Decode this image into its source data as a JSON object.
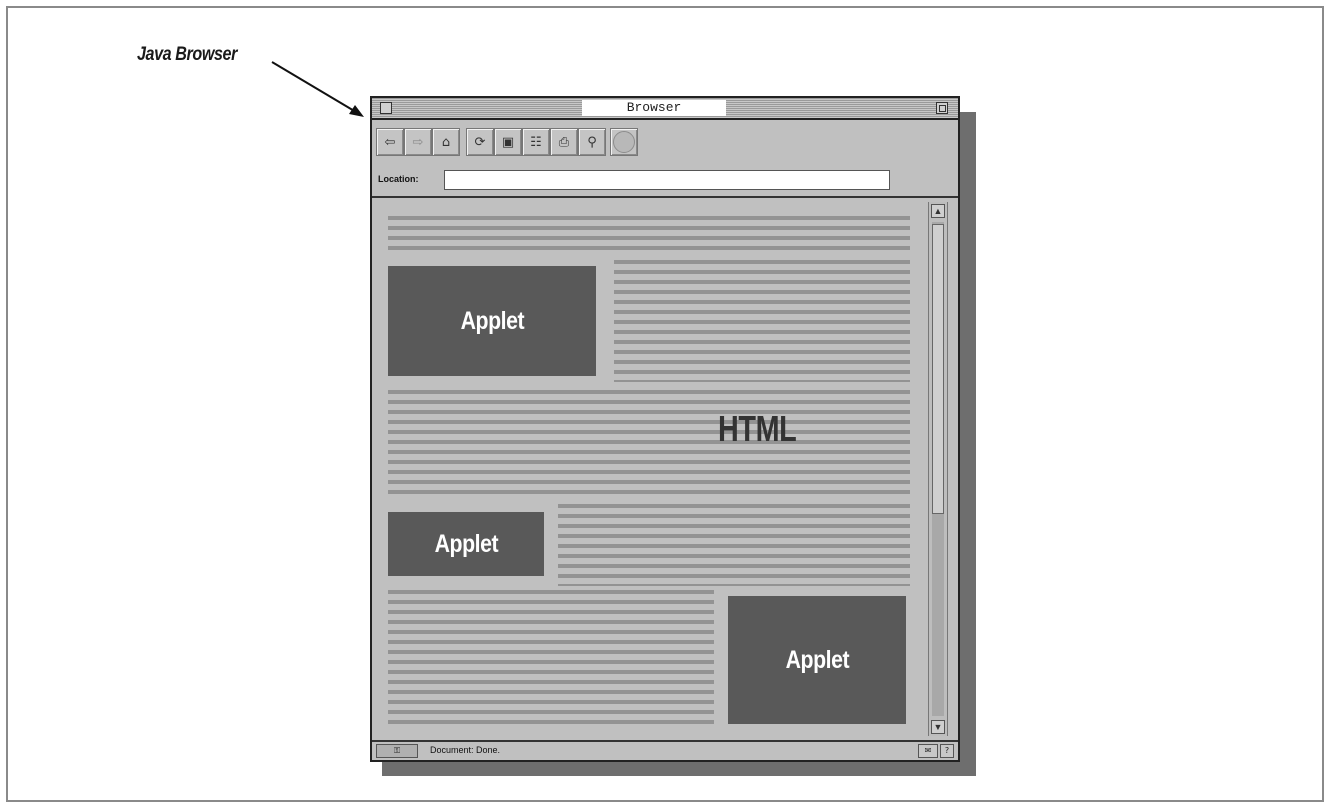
{
  "callout": {
    "label": "Java Browser"
  },
  "window": {
    "title": "Browser",
    "toolbar": {
      "buttons": [
        {
          "icon": "back-icon",
          "glyph": "⇦"
        },
        {
          "icon": "forward-icon",
          "glyph": "⇨"
        },
        {
          "icon": "home-icon",
          "glyph": "⌂"
        },
        {
          "icon": "reload-icon",
          "glyph": "⟳"
        },
        {
          "icon": "images-icon",
          "glyph": "▣"
        },
        {
          "icon": "open-icon",
          "glyph": "☷"
        },
        {
          "icon": "print-icon",
          "glyph": "⎙"
        },
        {
          "icon": "find-icon",
          "glyph": "⚲"
        },
        {
          "icon": "stop-icon",
          "glyph": ""
        }
      ],
      "location_label": "Location:",
      "location_value": ""
    },
    "content": {
      "applet_label": "Applet",
      "html_label": "HTML"
    },
    "status": {
      "text": "Document: Done.",
      "security_icon": "security-key-icon",
      "right_icons": [
        "mail-icon",
        "help-icon"
      ]
    }
  }
}
